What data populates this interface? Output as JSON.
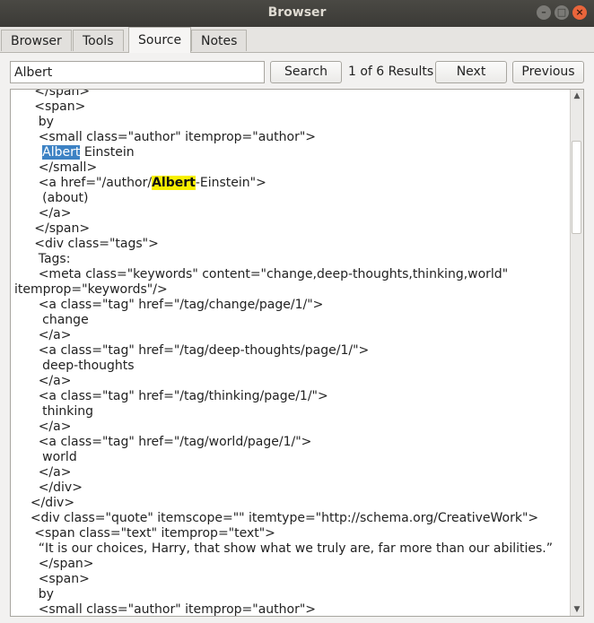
{
  "window": {
    "title": "Browser"
  },
  "tabs": [
    {
      "label": "Browser"
    },
    {
      "label": "Tools"
    },
    {
      "label": "Source"
    },
    {
      "label": "Notes"
    }
  ],
  "toolbar": {
    "search_value": "Albert",
    "search_label": "Search",
    "results_text": "1 of 6 Results",
    "next_label": "Next",
    "previous_label": "Previous"
  },
  "source_lines": [
    {
      "indent": "     ",
      "text": "</span>"
    },
    {
      "indent": "     ",
      "text": "<span>"
    },
    {
      "indent": "      ",
      "text": "by"
    },
    {
      "indent": "      ",
      "text": "<small class=\"author\" itemprop=\"author\">"
    },
    {
      "indent": "       ",
      "pre": "",
      "match": "Albert",
      "match_style": "selected",
      "post": " Einstein"
    },
    {
      "indent": "      ",
      "text": "</small>"
    },
    {
      "indent": "      ",
      "pre": "<a href=\"/author/",
      "match": "Albert",
      "match_style": "found",
      "post": "-Einstein\">"
    },
    {
      "indent": "       ",
      "text": "(about)"
    },
    {
      "indent": "      ",
      "text": "</a>"
    },
    {
      "indent": "     ",
      "text": "</span>"
    },
    {
      "indent": "     ",
      "text": "<div class=\"tags\">"
    },
    {
      "indent": "      ",
      "text": "Tags:"
    },
    {
      "indent": "      ",
      "text": "<meta class=\"keywords\" content=\"change,deep-thoughts,thinking,world\""
    },
    {
      "indent": "",
      "text": "itemprop=\"keywords\"/>"
    },
    {
      "indent": "      ",
      "text": "<a class=\"tag\" href=\"/tag/change/page/1/\">"
    },
    {
      "indent": "       ",
      "text": "change"
    },
    {
      "indent": "      ",
      "text": "</a>"
    },
    {
      "indent": "      ",
      "text": "<a class=\"tag\" href=\"/tag/deep-thoughts/page/1/\">"
    },
    {
      "indent": "       ",
      "text": "deep-thoughts"
    },
    {
      "indent": "      ",
      "text": "</a>"
    },
    {
      "indent": "      ",
      "text": "<a class=\"tag\" href=\"/tag/thinking/page/1/\">"
    },
    {
      "indent": "       ",
      "text": "thinking"
    },
    {
      "indent": "      ",
      "text": "</a>"
    },
    {
      "indent": "      ",
      "text": "<a class=\"tag\" href=\"/tag/world/page/1/\">"
    },
    {
      "indent": "       ",
      "text": "world"
    },
    {
      "indent": "      ",
      "text": "</a>"
    },
    {
      "indent": "      ",
      "text": "</div>"
    },
    {
      "indent": "    ",
      "text": "</div>"
    },
    {
      "indent": "    ",
      "text": "<div class=\"quote\" itemscope=\"\" itemtype=\"http://schema.org/CreativeWork\">"
    },
    {
      "indent": "     ",
      "text": "<span class=\"text\" itemprop=\"text\">"
    },
    {
      "indent": "      ",
      "text": "“It is our choices, Harry, that show what we truly are, far more than our abilities.”"
    },
    {
      "indent": "      ",
      "text": "</span>"
    },
    {
      "indent": "      ",
      "text": "<span>"
    },
    {
      "indent": "      ",
      "text": "by"
    },
    {
      "indent": "      ",
      "text": "<small class=\"author\" itemprop=\"author\">"
    }
  ]
}
